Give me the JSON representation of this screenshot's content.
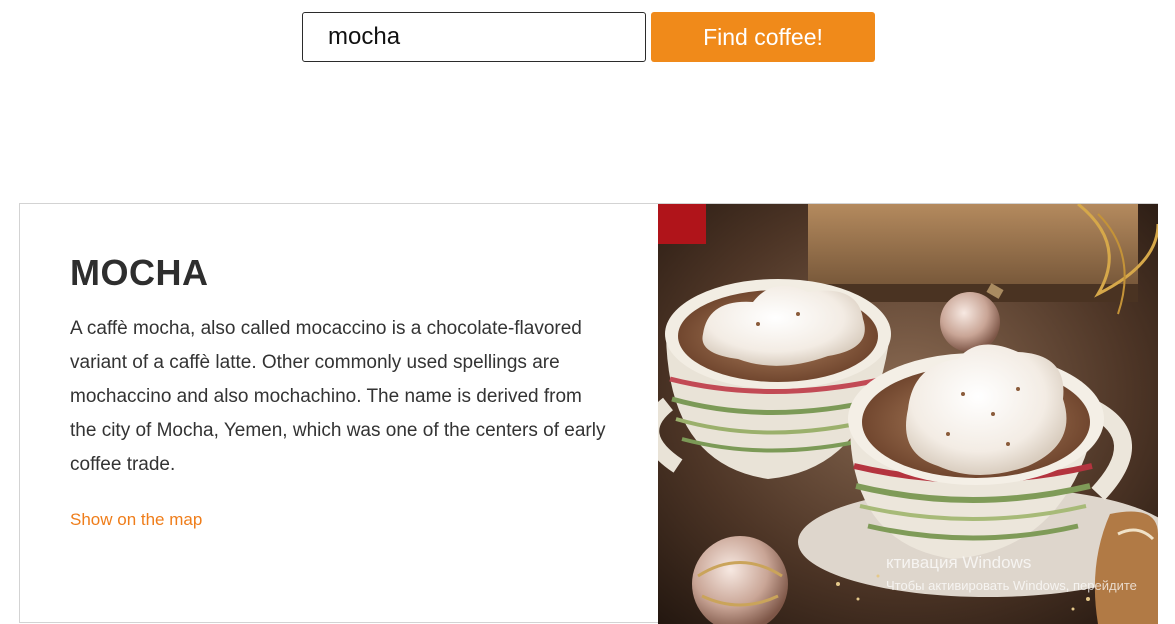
{
  "search": {
    "value": "mocha",
    "button_label": "Find coffee!"
  },
  "result": {
    "title": "MOCHA",
    "description": "A caffè mocha, also called mocaccino is a chocolate-flavored variant of a caffè latte. Other commonly used spellings are mochaccino and also mochachino. The name is derived from the city of Mocha, Yemen, which was one of the centers of early coffee trade.",
    "map_link": "Show on the map",
    "image_icon": "mocha-photo"
  },
  "watermark": {
    "line1": "ктивация Windows",
    "line2": "Чтобы активировать Windows, перейдите"
  },
  "colors": {
    "accent": "#f08a1a",
    "link": "#ef7d1a",
    "text": "#333333",
    "border": "#d3d3d3"
  }
}
